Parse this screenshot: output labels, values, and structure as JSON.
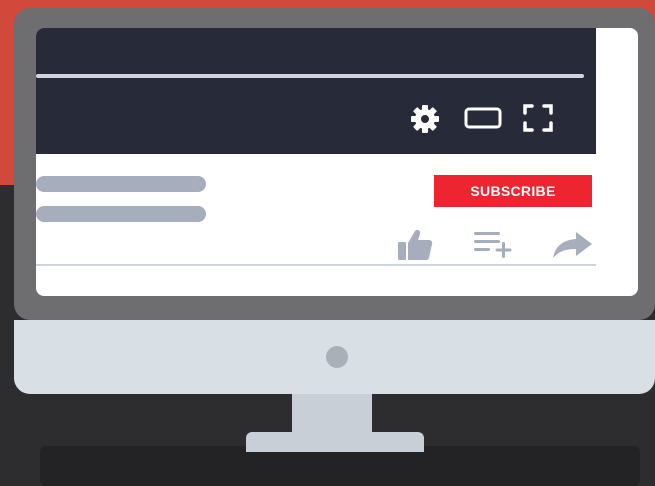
{
  "colors": {
    "background_top": "#d2493b",
    "background_bottom": "#2d2d30",
    "monitor_bezel": "#6e6e70",
    "monitor_chin": "#d9e0e5",
    "player_bar": "#272a38",
    "subscribe_red": "#ee2430",
    "icon_gray": "#a6adbd"
  },
  "player": {
    "controls": [
      "gear-icon",
      "theater-mode-icon",
      "fullscreen-icon"
    ]
  },
  "video_actions": {
    "subscribe_label": "SUBSCRIBE",
    "icons": [
      "thumbs-up-icon",
      "add-to-playlist-icon",
      "share-icon"
    ]
  }
}
